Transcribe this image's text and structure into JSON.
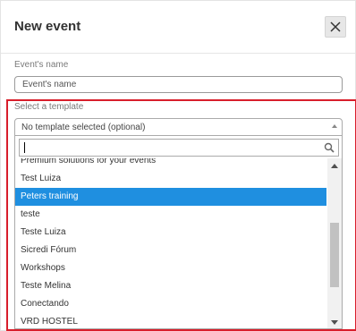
{
  "dialog": {
    "title": "New event",
    "close_icon": "close-icon"
  },
  "event_name": {
    "label": "Event's name",
    "placeholder": "Event's name"
  },
  "template": {
    "label": "Select a template",
    "selected_value": "No template selected (optional)",
    "search_value": "",
    "options": [
      "Premium solutions for your events",
      "Test Luiza",
      "Peters training",
      "teste",
      "Teste Luiza",
      "Sicredi Fórum",
      "Workshops",
      "Teste Melina",
      "Conectando",
      "VRD HOSTEL"
    ],
    "highlighted_option": "Peters training"
  },
  "colors": {
    "highlight_border": "#d81e2b",
    "selected_option_bg": "#1f8fe0"
  }
}
